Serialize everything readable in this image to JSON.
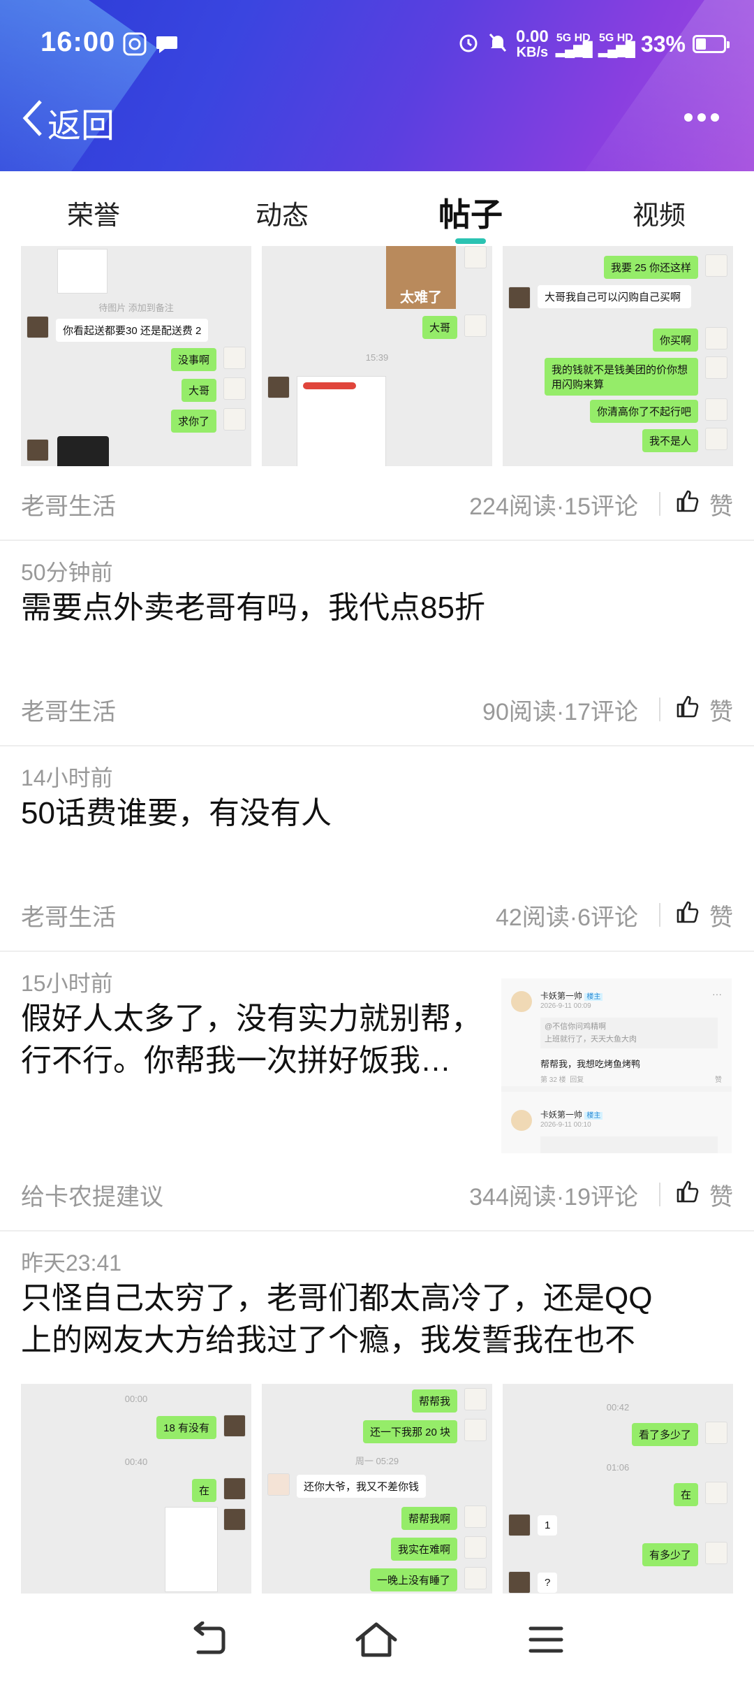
{
  "status_bar": {
    "time": "16:00",
    "net_speed_value": "0.00",
    "net_speed_unit": "KB/s",
    "sim1": "5G HD",
    "sim2": "5G HD",
    "battery": "33%"
  },
  "nav": {
    "back_label": "返回"
  },
  "tabs": [
    {
      "label": "荣誉"
    },
    {
      "label": "动态"
    },
    {
      "label": "帖子"
    },
    {
      "label": "视频"
    }
  ],
  "posts": [
    {
      "source": "老哥生活",
      "stats": "224阅读·15评论",
      "like_label": "赞",
      "thumb1": {
        "top_text": "待图片 添加到备注",
        "line1": "你看起送都要30 还是配送费 2",
        "b1": "没事啊",
        "b2": "大哥",
        "b3": "求你了"
      },
      "thumb2": {
        "sticker_text": "太难了",
        "b1": "大哥",
        "ts": "15:39"
      },
      "thumb3": {
        "b1": "我要 25 你还这样",
        "w1": "大哥我自己可以闪购自己买啊",
        "b2": "你买啊",
        "b3": "我的钱就不是钱美团的价你想用闪购来算",
        "b4": "你清高你了不起行吧",
        "b5": "我不是人"
      }
    },
    {
      "time": "50分钟前",
      "title": "需要点外卖老哥有吗，我代点85折",
      "source": "老哥生活",
      "stats": "90阅读·17评论",
      "like_label": "赞"
    },
    {
      "time": "14小时前",
      "title": "50话费谁要，有没有人",
      "source": "老哥生活",
      "stats": "42阅读·6评论",
      "like_label": "赞"
    },
    {
      "time": "15小时前",
      "title_line1": "假好人太多了，没有实力就别帮，",
      "title_line2": "行不行。你帮我一次拼好饭我…",
      "source": "给卡农提建议",
      "stats": "344阅读·19评论",
      "like_label": "赞",
      "rthumb": {
        "name1": "卡妖第一帅",
        "tag_owner": "楼主",
        "date1": "2026-9-11 00:09",
        "quote1": "@不信你问鸡精啊",
        "quote1b": "上班就行了，天天大鱼大肉",
        "reply1": "帮帮我，我想吃烤鱼烤鸭",
        "floor1": "第 32 楼",
        "reply_btn": "回复",
        "like_small": "赞",
        "name2": "卡妖第一帅",
        "date2": "2026-9-11 00:10"
      }
    },
    {
      "time": "昨天23:41",
      "title_line1": "只怪自己太穷了，老哥们都太高冷了，还是QQ",
      "title_line2": "上的网友大方给我过了个瘾，我发誓我在也不",
      "thumb1": {
        "ts1": "00:00",
        "b1": "18 有没有",
        "ts2": "00:40",
        "b2": "在"
      },
      "thumb2": {
        "b1": "帮帮我",
        "b2": "还一下我那 20 块",
        "ts": "周一 05:29",
        "w1": "还你大爷，我又不差你钱",
        "b3": "帮帮我啊",
        "b4": "我实在难啊",
        "b5": "一晚上没有睡了"
      },
      "thumb3": {
        "ts1": "00:42",
        "b1": "看了多少了",
        "ts2": "01:06",
        "b2": "在",
        "w1": "1",
        "b3": "有多少了",
        "w2": "?"
      }
    }
  ]
}
